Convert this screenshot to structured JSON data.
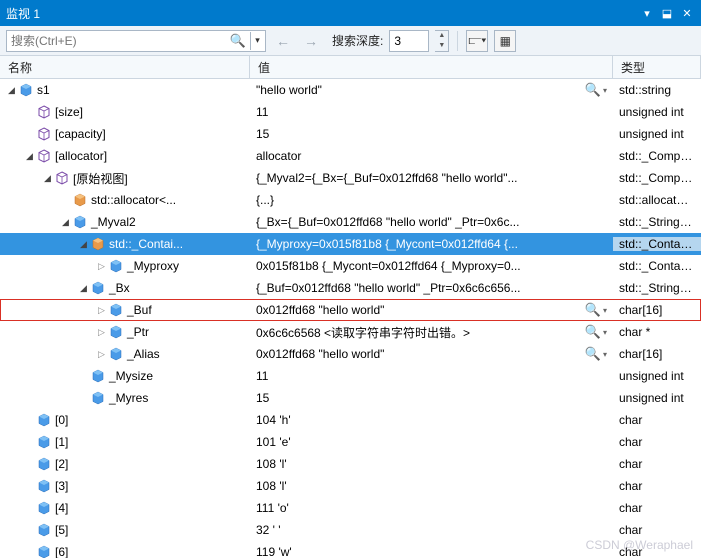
{
  "window": {
    "title": "监视 1"
  },
  "toolbar": {
    "search_placeholder": "搜索(Ctrl+E)",
    "depth_label": "搜索深度:",
    "depth_value": "3"
  },
  "headers": {
    "name": "名称",
    "value": "值",
    "type": "类型"
  },
  "watermark": "CSDN @Weraphael",
  "rows": [
    {
      "indent": 0,
      "exp": "expanded",
      "icon": "cube-blue",
      "name": "s1",
      "value": "\"hello world\"",
      "mag": true,
      "type": "std::string"
    },
    {
      "indent": 1,
      "exp": "none",
      "icon": "cube-outline",
      "name": "[size]",
      "value": "11",
      "type": "unsigned int"
    },
    {
      "indent": 1,
      "exp": "none",
      "icon": "cube-outline",
      "name": "[capacity]",
      "value": "15",
      "type": "unsigned int"
    },
    {
      "indent": 1,
      "exp": "expanded",
      "icon": "cube-outline",
      "name": "[allocator]",
      "value": "allocator",
      "type": "std::_Compres..."
    },
    {
      "indent": 2,
      "exp": "expanded",
      "icon": "cube-outline",
      "name": "[原始视图]",
      "value": "{_Myval2={_Bx={_Buf=0x012ffd68 \"hello world\"...",
      "type": "std::_Compres..."
    },
    {
      "indent": 3,
      "exp": "none",
      "icon": "cube-orange",
      "name": "std::allocator<...",
      "value": "{...}",
      "type": "std::allocator..."
    },
    {
      "indent": 3,
      "exp": "expanded",
      "icon": "cube-blue",
      "name": "_Myval2",
      "value": "{_Bx={_Buf=0x012ffd68 \"hello world\" _Ptr=0x6c...",
      "type": "std::_String_va..."
    },
    {
      "indent": 4,
      "exp": "expanded",
      "icon": "cube-orange",
      "name": "std::_Contai...",
      "value": "{_Myproxy=0x015f81b8 {_Mycont=0x012ffd64 {...",
      "type": "std::_Containe...",
      "selected": true
    },
    {
      "indent": 5,
      "exp": "collapsed",
      "icon": "cube-blue",
      "name": "_Myproxy",
      "value": "0x015f81b8 {_Mycont=0x012ffd64 {_Myproxy=0...",
      "type": "std::_Containe..."
    },
    {
      "indent": 4,
      "exp": "expanded",
      "icon": "cube-blue",
      "name": "_Bx",
      "value": "{_Buf=0x012ffd68 \"hello world\" _Ptr=0x6c6c656...",
      "type": "std::_String_va..."
    },
    {
      "indent": 5,
      "exp": "collapsed",
      "icon": "cube-blue",
      "name": "_Buf",
      "value": "0x012ffd68 \"hello world\"",
      "mag": true,
      "type": "char[16]",
      "boxed": true
    },
    {
      "indent": 5,
      "exp": "collapsed",
      "icon": "cube-blue",
      "name": "_Ptr",
      "value": "0x6c6c6568 <读取字符串字符时出错。>",
      "mag": true,
      "type": "char *"
    },
    {
      "indent": 5,
      "exp": "collapsed",
      "icon": "cube-blue",
      "name": "_Alias",
      "value": "0x012ffd68 \"hello world\"",
      "mag": true,
      "type": "char[16]"
    },
    {
      "indent": 4,
      "exp": "none",
      "icon": "cube-blue",
      "name": "_Mysize",
      "value": "11",
      "type": "unsigned int"
    },
    {
      "indent": 4,
      "exp": "none",
      "icon": "cube-blue",
      "name": "_Myres",
      "value": "15",
      "type": "unsigned int"
    },
    {
      "indent": 1,
      "exp": "none",
      "icon": "cube-blue",
      "name": "[0]",
      "value": "104 'h'",
      "type": "char"
    },
    {
      "indent": 1,
      "exp": "none",
      "icon": "cube-blue",
      "name": "[1]",
      "value": "101 'e'",
      "type": "char"
    },
    {
      "indent": 1,
      "exp": "none",
      "icon": "cube-blue",
      "name": "[2]",
      "value": "108 'l'",
      "type": "char"
    },
    {
      "indent": 1,
      "exp": "none",
      "icon": "cube-blue",
      "name": "[3]",
      "value": "108 'l'",
      "type": "char"
    },
    {
      "indent": 1,
      "exp": "none",
      "icon": "cube-blue",
      "name": "[4]",
      "value": "111 'o'",
      "type": "char"
    },
    {
      "indent": 1,
      "exp": "none",
      "icon": "cube-blue",
      "name": "[5]",
      "value": "32 ' '",
      "type": "char"
    },
    {
      "indent": 1,
      "exp": "none",
      "icon": "cube-blue",
      "name": "[6]",
      "value": "119 'w'",
      "type": "char"
    }
  ]
}
